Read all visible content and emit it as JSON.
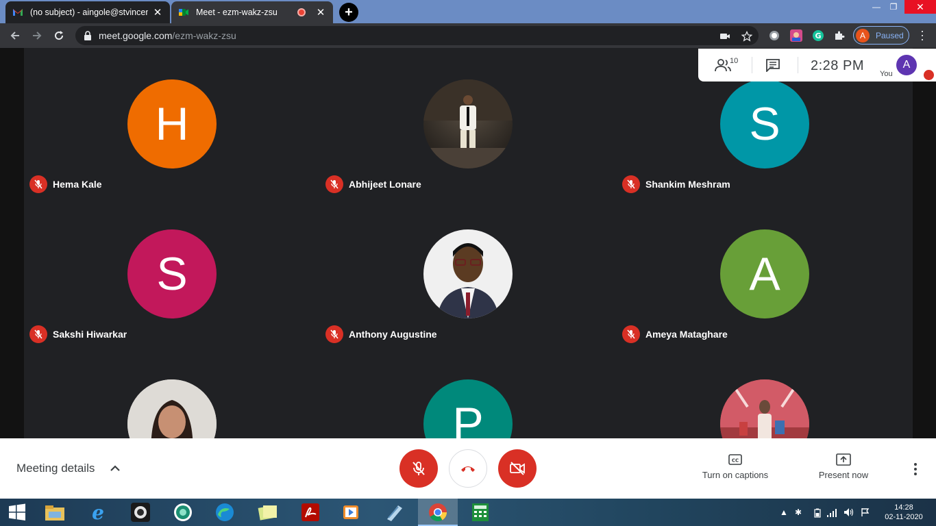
{
  "browser": {
    "tabs": [
      {
        "title": "(no subject) - aingole@stvincentngp",
        "favicon": "gmail-icon",
        "active": false
      },
      {
        "title": "Meet - ezm-wakz-zsu",
        "favicon": "meet-icon",
        "active": true,
        "recording": true
      }
    ],
    "url_host": "meet.google.com",
    "url_path": "/ezm-wakz-zsu",
    "profile_initial": "A",
    "profile_status": "Paused"
  },
  "meet": {
    "participant_count": "10",
    "time": "2:28  PM",
    "you_label": "You",
    "you_initial": "A",
    "participants": [
      {
        "name": "Hema Kale",
        "initial": "H",
        "color": "#ef6c00",
        "photo": false
      },
      {
        "name": "Abhijeet Lonare",
        "initial": "",
        "color": "#1e1e1e",
        "photo": true
      },
      {
        "name": "Shankim Meshram",
        "initial": "S",
        "color": "#0097a7",
        "photo": false
      },
      {
        "name": "Sakshi Hiwarkar",
        "initial": "S",
        "color": "#c2185b",
        "photo": false
      },
      {
        "name": "Anthony Augustine",
        "initial": "",
        "color": "#e8e8e8",
        "photo": true
      },
      {
        "name": "Ameya Mataghare",
        "initial": "A",
        "color": "#689f38",
        "photo": false
      },
      {
        "name": "",
        "initial": "",
        "color": "#dcdcdc",
        "photo": true
      },
      {
        "name": "",
        "initial": "P",
        "color": "#00897b",
        "photo": false
      },
      {
        "name": "",
        "initial": "",
        "color": "#c0585a",
        "photo": true
      }
    ],
    "bottom": {
      "meeting_details": "Meeting details",
      "captions": "Turn on captions",
      "present": "Present now"
    }
  },
  "taskbar": {
    "time": "14:28",
    "date": "02-11-2020"
  }
}
